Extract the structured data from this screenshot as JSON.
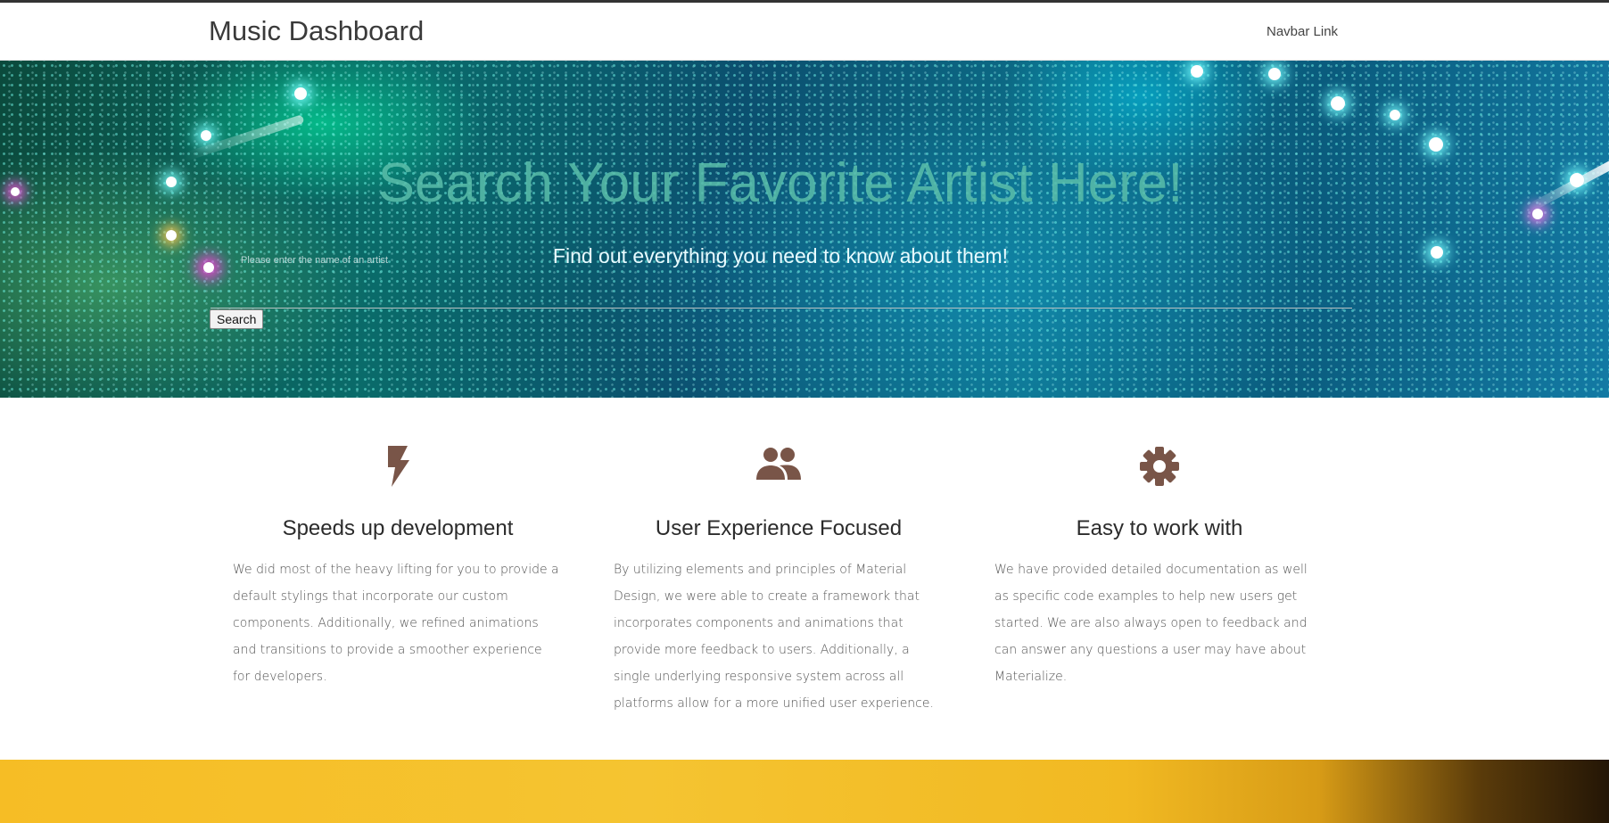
{
  "navbar": {
    "brand": "Music Dashboard",
    "link": "Navbar Link"
  },
  "hero": {
    "title": "Search Your Favorite Artist Here!",
    "subtitle": "Find out everything you need to know about them!",
    "search_label": "Please enter the name of an artist",
    "search_value": "",
    "search_button": "Search"
  },
  "features": [
    {
      "icon": "flash-icon",
      "title": "Speeds up development",
      "text": "We did most of the heavy lifting for you to provide a default stylings that incorporate our custom components. Additionally, we refined animations and transitions to provide a smoother experience for developers."
    },
    {
      "icon": "group-icon",
      "title": "User Experience Focused",
      "text": "By utilizing elements and principles of Material Design, we were able to create a framework that incorporates components and animations that provide more feedback to users. Additionally, a single underlying responsive system across all platforms allow for a more unified user experience."
    },
    {
      "icon": "settings-icon",
      "title": "Easy to work with",
      "text": "We have provided detailed documentation as well as specific code examples to help new users get started. We are also always open to feedback and can answer any questions a user may have about Materialize."
    }
  ],
  "colors": {
    "icon": "#795548",
    "navbar_bg": "#ffffff",
    "title_tint": "#5abeaa"
  }
}
